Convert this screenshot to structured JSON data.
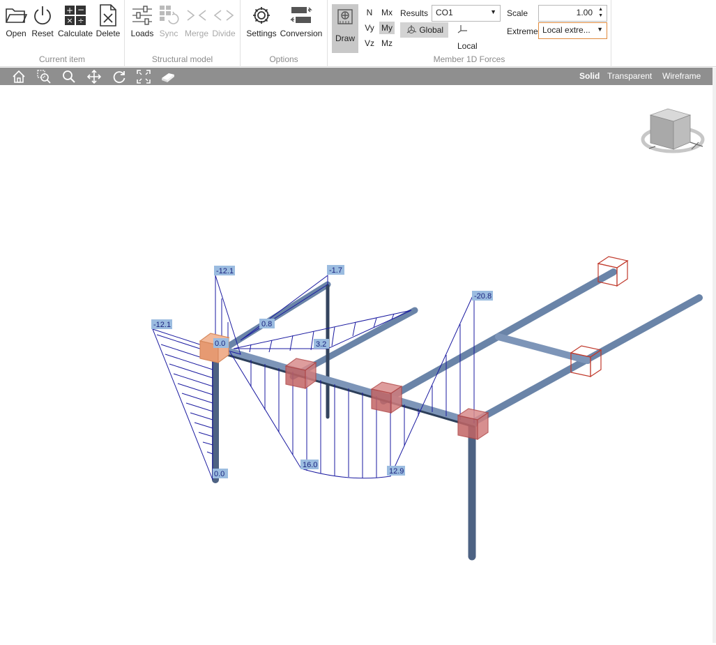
{
  "ribbon": {
    "current_item": {
      "label": "Current item",
      "buttons": [
        {
          "label": "Open",
          "icon": "folder-open-icon"
        },
        {
          "label": "Reset",
          "icon": "power-icon"
        },
        {
          "label": "Calculate",
          "icon": "calculator-icon"
        },
        {
          "label": "Delete",
          "icon": "delete-file-icon"
        }
      ]
    },
    "structural_model": {
      "label": "Structural model",
      "buttons": [
        {
          "label": "Loads",
          "icon": "sliders-icon",
          "enabled": true
        },
        {
          "label": "Sync",
          "icon": "sync-icon",
          "enabled": false
        },
        {
          "label": "Merge",
          "icon": "merge-icon",
          "enabled": false
        },
        {
          "label": "Divide",
          "icon": "divide-icon",
          "enabled": false
        }
      ]
    },
    "options": {
      "label": "Options",
      "buttons": [
        {
          "label": "Settings",
          "icon": "gear-icon"
        },
        {
          "label": "Conversion",
          "icon": "conversion-icon"
        }
      ]
    },
    "member_forces": {
      "label": "Member 1D Forces",
      "draw_label": "Draw",
      "forces": [
        "N",
        "Mx",
        "Vy",
        "My",
        "Vz",
        "Mz"
      ],
      "active_force": "My",
      "results_label": "Results",
      "results_value": "CO1",
      "global_label": "Global",
      "local_label": "Local",
      "scale_label": "Scale",
      "scale_value": "1.00",
      "extreme_label": "Extreme",
      "extreme_value": "Local extre..."
    }
  },
  "viewbar": {
    "modes": [
      "Solid",
      "Transparent",
      "Wireframe"
    ],
    "active_mode": "Solid",
    "icons": [
      "home-icon",
      "zoom-window-icon",
      "search-icon",
      "pan-icon",
      "rotate-icon",
      "fit-view-icon",
      "eraser-icon"
    ]
  },
  "viewport": {
    "labels": {
      "col1_top": "-12.1",
      "col1_bottom": "0.0",
      "beam1_left": "-12.1",
      "beam1_mid": "0.0",
      "beam2_top": "-1.7",
      "beam2_mid1": "0.8",
      "beam2_mid2": "3.2",
      "main_bottom1": "16.0",
      "main_bottom2": "12.9",
      "main_top": "-20.8"
    }
  },
  "colors": {
    "diagram": "#1a1aa0",
    "member": "#7d95b8",
    "support": "#c0392b",
    "label_bg": "#9bbce0"
  }
}
